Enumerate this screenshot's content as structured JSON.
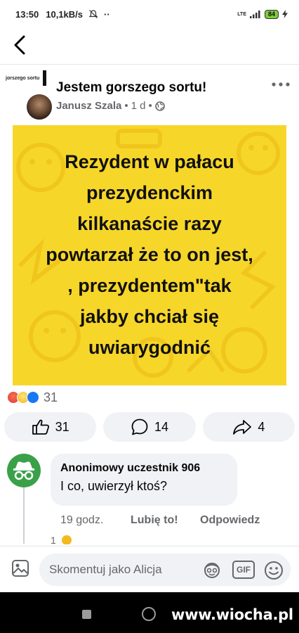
{
  "status_bar": {
    "time": "13:50",
    "network_speed": "10,1kB/s",
    "battery": "84",
    "lte": "LTE",
    "dots": "··"
  },
  "post": {
    "group_logo_text": "jorszego sortu",
    "group_name": "Jestem gorszego sortu!",
    "author": "Janusz Szala",
    "time": "1 d",
    "image_lines": [
      "Rezydent w pałacu",
      "prezydenckim",
      "kilkanaście razy",
      "powtarzał że to on jest,",
      ", prezydentem\"tak",
      "jakby chciał się",
      "uwiarygodnić"
    ],
    "reaction_count": "31",
    "actions": {
      "like_count": "31",
      "comment_count": "14",
      "share_count": "4"
    }
  },
  "comment": {
    "author": "Anonimowy uczestnik 906",
    "text": "I co, uwierzył ktoś?",
    "time": "19 godz.",
    "like_label": "Lubię to!",
    "reply_label": "Odpowiedz",
    "reply_peek": "1"
  },
  "composer": {
    "placeholder": "Skomentuj jako Alicja",
    "gif_label": "GIF"
  },
  "watermark": {
    "prefix": "www.",
    "name": "wiocha",
    "suffix": ".pl"
  },
  "colors": {
    "image_background": "#f7d62a",
    "accent_blue": "#1877f2",
    "comment_avatar": "#3aa149",
    "button_background": "#f0f2f5"
  }
}
